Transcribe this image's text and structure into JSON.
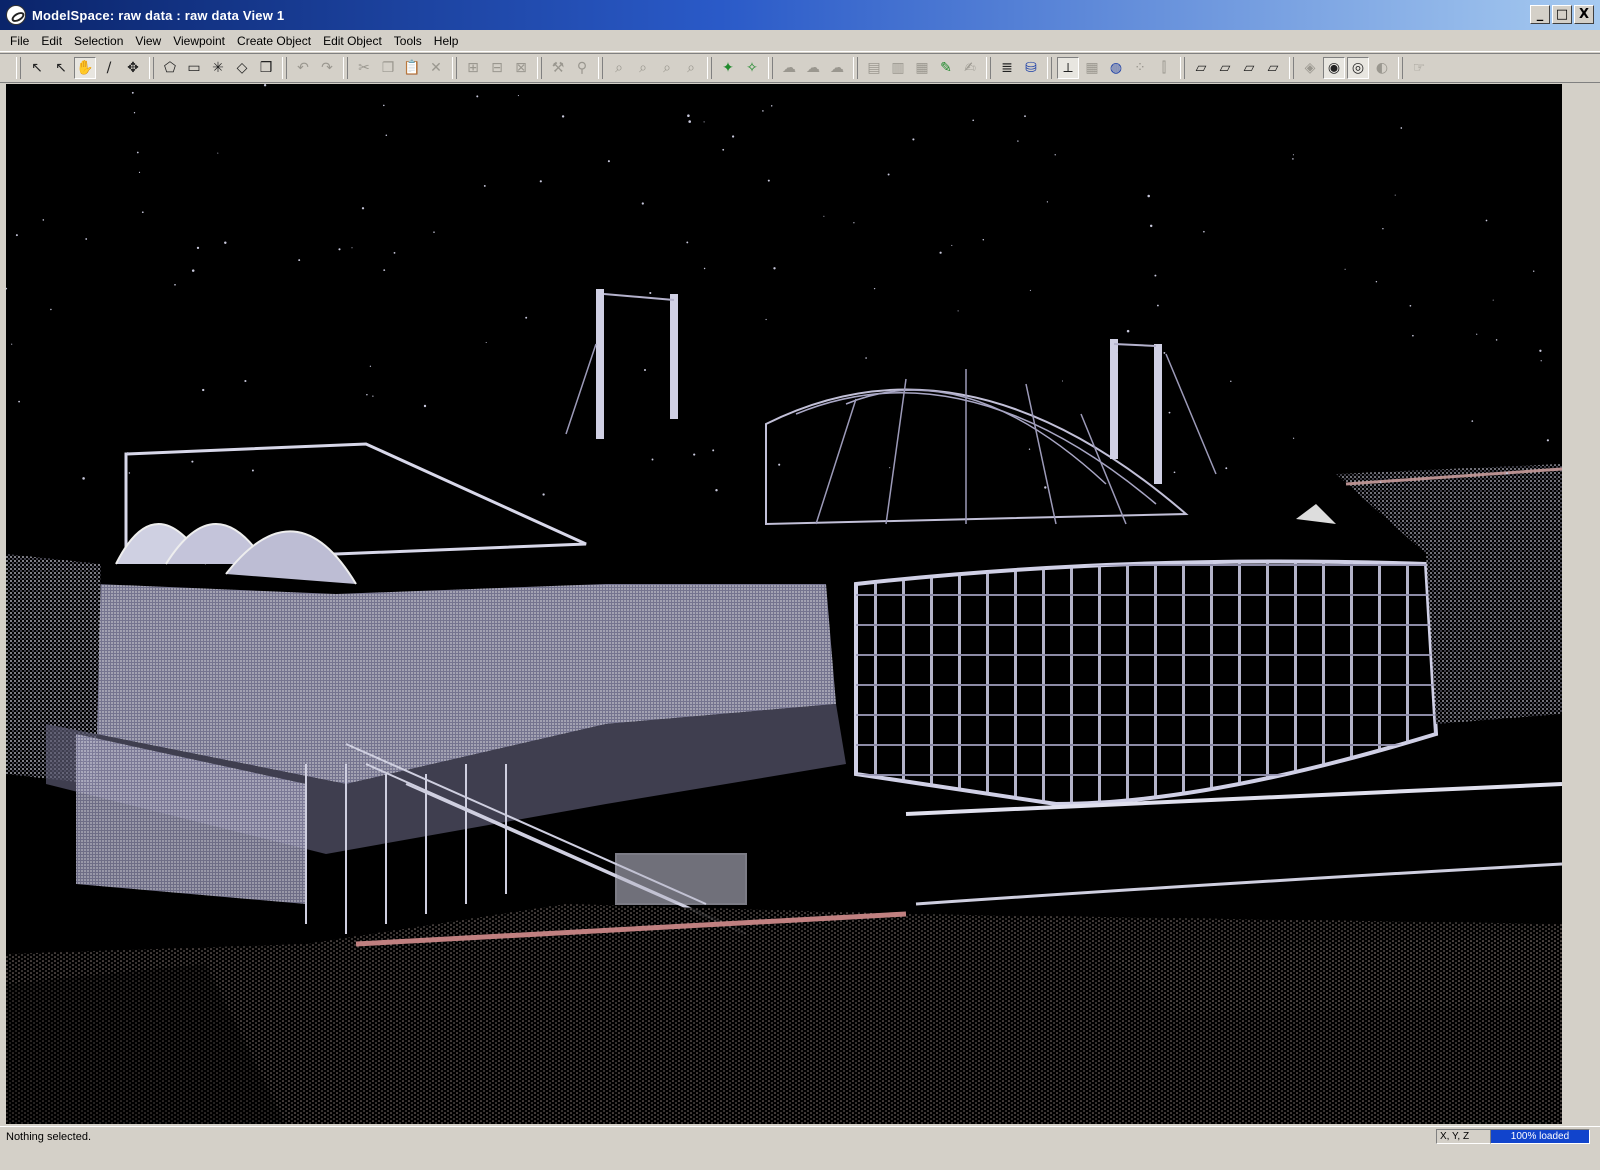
{
  "window": {
    "title": "ModelSpace: raw data : raw data View 1",
    "buttons": {
      "minimize": "_",
      "maximize": "□",
      "close": "X"
    }
  },
  "menubar": {
    "items": [
      "File",
      "Edit",
      "Selection",
      "View",
      "Viewpoint",
      "Create Object",
      "Edit Object",
      "Tools",
      "Help"
    ]
  },
  "toolbar": {
    "groups": [
      [
        {
          "icon": "arrow-select-icon",
          "glyph": "↖",
          "state": "normal"
        },
        {
          "icon": "arrow-add-select-icon",
          "glyph": "↖",
          "state": "normal"
        },
        {
          "icon": "hand-pan-icon",
          "glyph": "✋",
          "state": "active"
        },
        {
          "icon": "pen-icon",
          "glyph": "/",
          "state": "normal"
        },
        {
          "icon": "move-icon",
          "glyph": "✥",
          "state": "normal"
        }
      ],
      [
        {
          "icon": "fence-polygon-icon",
          "glyph": "⬠",
          "state": "normal"
        },
        {
          "icon": "rectangle-select-icon",
          "glyph": "▭",
          "state": "normal"
        },
        {
          "icon": "sparkle-icon",
          "glyph": "✳",
          "state": "normal"
        },
        {
          "icon": "eraser-icon",
          "glyph": "◇",
          "state": "normal"
        },
        {
          "icon": "cube-icon",
          "glyph": "❒",
          "state": "normal"
        }
      ],
      [
        {
          "icon": "undo-icon",
          "glyph": "↶",
          "state": "disabled"
        },
        {
          "icon": "redo-icon",
          "glyph": "↷",
          "state": "disabled"
        }
      ],
      [
        {
          "icon": "cut-icon",
          "glyph": "✂",
          "state": "disabled"
        },
        {
          "icon": "copy-icon",
          "glyph": "❐",
          "state": "disabled"
        },
        {
          "icon": "paste-icon",
          "glyph": "📋",
          "state": "disabled"
        },
        {
          "icon": "delete-icon",
          "glyph": "✕",
          "state": "disabled"
        }
      ],
      [
        {
          "icon": "group-icon",
          "glyph": "⊞",
          "state": "disabled"
        },
        {
          "icon": "ungroup-icon",
          "glyph": "⊟",
          "state": "disabled"
        },
        {
          "icon": "explode-icon",
          "glyph": "⊠",
          "state": "disabled"
        }
      ],
      [
        {
          "icon": "fit-cloud-icon",
          "glyph": "⚒",
          "state": "disabled"
        },
        {
          "icon": "region-grow-icon",
          "glyph": "⚲",
          "state": "disabled"
        }
      ],
      [
        {
          "icon": "zoom-extents-icon",
          "glyph": "⌕",
          "state": "disabled"
        },
        {
          "icon": "zoom-in-icon",
          "glyph": "⌕",
          "state": "disabled"
        },
        {
          "icon": "zoom-out-icon",
          "glyph": "⌕",
          "state": "disabled"
        },
        {
          "icon": "zoom-window-icon",
          "glyph": "⌕",
          "state": "disabled"
        }
      ],
      [
        {
          "icon": "seek-icon",
          "glyph": "✦",
          "state": "green"
        },
        {
          "icon": "walkthrough-icon",
          "glyph": "✧",
          "state": "green"
        }
      ],
      [
        {
          "icon": "fly-icon",
          "glyph": "☁",
          "state": "disabled"
        },
        {
          "icon": "examine-icon",
          "glyph": "☁",
          "state": "disabled"
        },
        {
          "icon": "orbit-icon",
          "glyph": "☁",
          "state": "disabled"
        }
      ],
      [
        {
          "icon": "layer-icon",
          "glyph": "▤",
          "state": "disabled"
        },
        {
          "icon": "object-list-icon",
          "glyph": "▥",
          "state": "disabled"
        },
        {
          "icon": "clip-box-icon",
          "glyph": "▦",
          "state": "disabled"
        },
        {
          "icon": "measure-icon",
          "glyph": "✎",
          "state": "green"
        },
        {
          "icon": "annotate-icon",
          "glyph": "✍",
          "state": "disabled"
        }
      ],
      [
        {
          "icon": "layers-stack-icon",
          "glyph": "≣",
          "state": "normal"
        },
        {
          "icon": "database-icon",
          "glyph": "⛁",
          "state": "blue"
        }
      ],
      [
        {
          "icon": "coordinate-axes-icon",
          "glyph": "⟂",
          "state": "active"
        },
        {
          "icon": "grid-icon",
          "glyph": "▦",
          "state": "disabled"
        },
        {
          "icon": "globe-icon",
          "glyph": "◍",
          "state": "blue"
        },
        {
          "icon": "scatter-icon",
          "glyph": "⁘",
          "state": "disabled"
        },
        {
          "icon": "align-icon",
          "glyph": "⫿",
          "state": "disabled"
        }
      ],
      [
        {
          "icon": "view-plane-1-icon",
          "glyph": "▱",
          "state": "normal"
        },
        {
          "icon": "view-plane-2-icon",
          "glyph": "▱",
          "state": "normal"
        },
        {
          "icon": "view-plane-3-icon",
          "glyph": "▱",
          "state": "normal"
        },
        {
          "icon": "view-plane-4-icon",
          "glyph": "▱",
          "state": "normal"
        }
      ],
      [
        {
          "icon": "render-points-icon",
          "glyph": "◈",
          "state": "disabled"
        },
        {
          "icon": "render-color-icon",
          "glyph": "◉",
          "state": "active"
        },
        {
          "icon": "render-intensity-icon",
          "glyph": "◎",
          "state": "active"
        },
        {
          "icon": "render-shade-icon",
          "glyph": "◐",
          "state": "disabled"
        }
      ],
      [
        {
          "icon": "hand-help-icon",
          "glyph": "☞",
          "state": "disabled"
        }
      ]
    ]
  },
  "viewport": {
    "description_visible": false,
    "background": "#000000",
    "point_cloud_colors": [
      "#e8e8f0",
      "#c8c8dc",
      "#9a98b8",
      "#d8b0b0",
      "#7a6a6a",
      "#ffffff"
    ]
  },
  "statusbar": {
    "message": "Nothing selected.",
    "coords_label": "X, Y, Z",
    "load_progress_text": "100% loaded",
    "load_progress_fraction": 1.0,
    "progress_color": "#1144cc"
  }
}
